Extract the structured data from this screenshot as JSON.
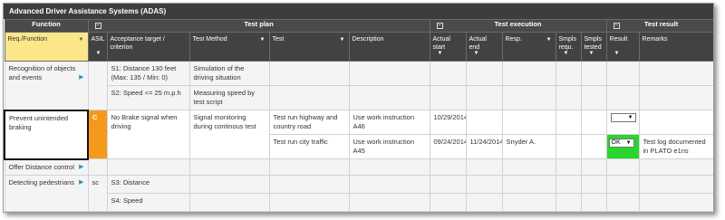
{
  "window": {
    "title": "Advanced Driver Assistance Systems (ADAS)"
  },
  "groups": {
    "function": "Function",
    "test_plan": "Test plan",
    "test_execution": "Test execution",
    "test_result": "Test result"
  },
  "columns": {
    "req_function": "Req./Function",
    "asil": "ASIL",
    "acceptance": "Acceptance target / criterion",
    "test_method": "Test Method",
    "test": "Test",
    "description": "Description",
    "actual_start": "Actual start",
    "actual_end": "Actual end",
    "resp": "Resp.",
    "samples_requ": "Smpls requ.",
    "samples_tested": "Smpls tested",
    "result": "Result",
    "remarks": "Remarks"
  },
  "rows": {
    "r1": {
      "function": "Recognition of objects and events",
      "acceptance_1": "S1: Distance 130 feet (Max: 135 / Min: 0)",
      "method_1": "Simulation of the driving situation",
      "acceptance_2": "S2: Speed <= 25 m.p.h",
      "method_2": "Measuring speed by test script"
    },
    "r2": {
      "function": "Prevent unintended braking",
      "asil": "C",
      "acceptance": "No Brake signal when driving",
      "method": "Signal monitoring during continous test",
      "test_1": "Test run highway and country road",
      "desc_1": "Use work instruction A46",
      "start_1": "10/29/2014",
      "result_1": "",
      "test_2": "Test run city traffic",
      "desc_2": "Use work instruction A45",
      "start_2": "09/24/2014",
      "end_2": "11/24/2014",
      "resp_2": "Snyder A.",
      "result_2": "OK",
      "remarks_2": "Test log documented in PLATO e1ns"
    },
    "r3": {
      "function": "Offer Distance control"
    },
    "r4": {
      "function": "Detecting pedestrians",
      "asil": "sc",
      "acceptance_1": "S3: Distance",
      "acceptance_2": "S4: Speed"
    }
  },
  "icons": {
    "filter": "filter-triangle-icon",
    "expand": "expand-arrow-icon",
    "collapse": "collapse-minus-icon",
    "dropdown": "chevron-down-icon"
  },
  "colors": {
    "header": "#424242",
    "req_header": "#fbe68a",
    "asil_c": "#f39a1c",
    "ok": "#29d62c",
    "arrow": "#3a8fc8"
  }
}
